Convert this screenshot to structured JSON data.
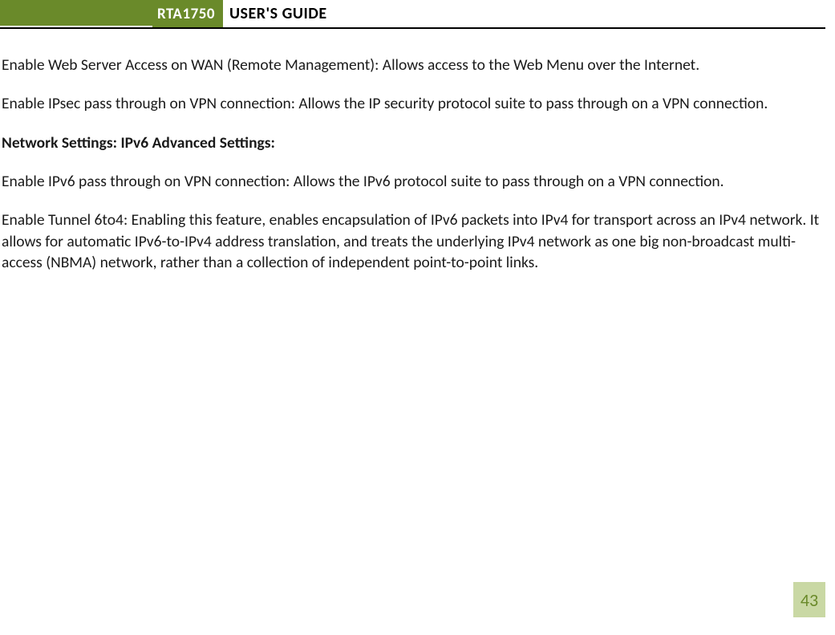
{
  "header": {
    "model": "RTA1750",
    "title": "USER'S GUIDE"
  },
  "body": {
    "p1": "Enable Web Server Access on WAN (Remote Management): Allows access to the Web Menu over the Internet.",
    "p2": "Enable IPsec pass through on VPN connection: Allows the IP security protocol suite to pass through on a VPN connection.",
    "heading_ns": "Network Settings",
    "heading_sep": ": ",
    "heading_ipv6": "IPv6 Advanced Settings:",
    "p3": "Enable IPv6 pass through on VPN connection: Allows the IPv6 protocol suite to pass through on a VPN connection.",
    "p4": "Enable Tunnel 6to4:  Enabling this feature, enables encapsulation of IPv6 packets into IPv4 for transport across an IPv4 network.  It allows for automatic IPv6-to-IPv4 address translation, and treats the underlying IPv4 network as one big non-broadcast multi-access (NBMA) network, rather than a collection of independent point-to-point links."
  },
  "page_number": "43",
  "colors": {
    "brand_green": "#6a8a2a",
    "page_badge_bg": "#c9d8a4"
  }
}
